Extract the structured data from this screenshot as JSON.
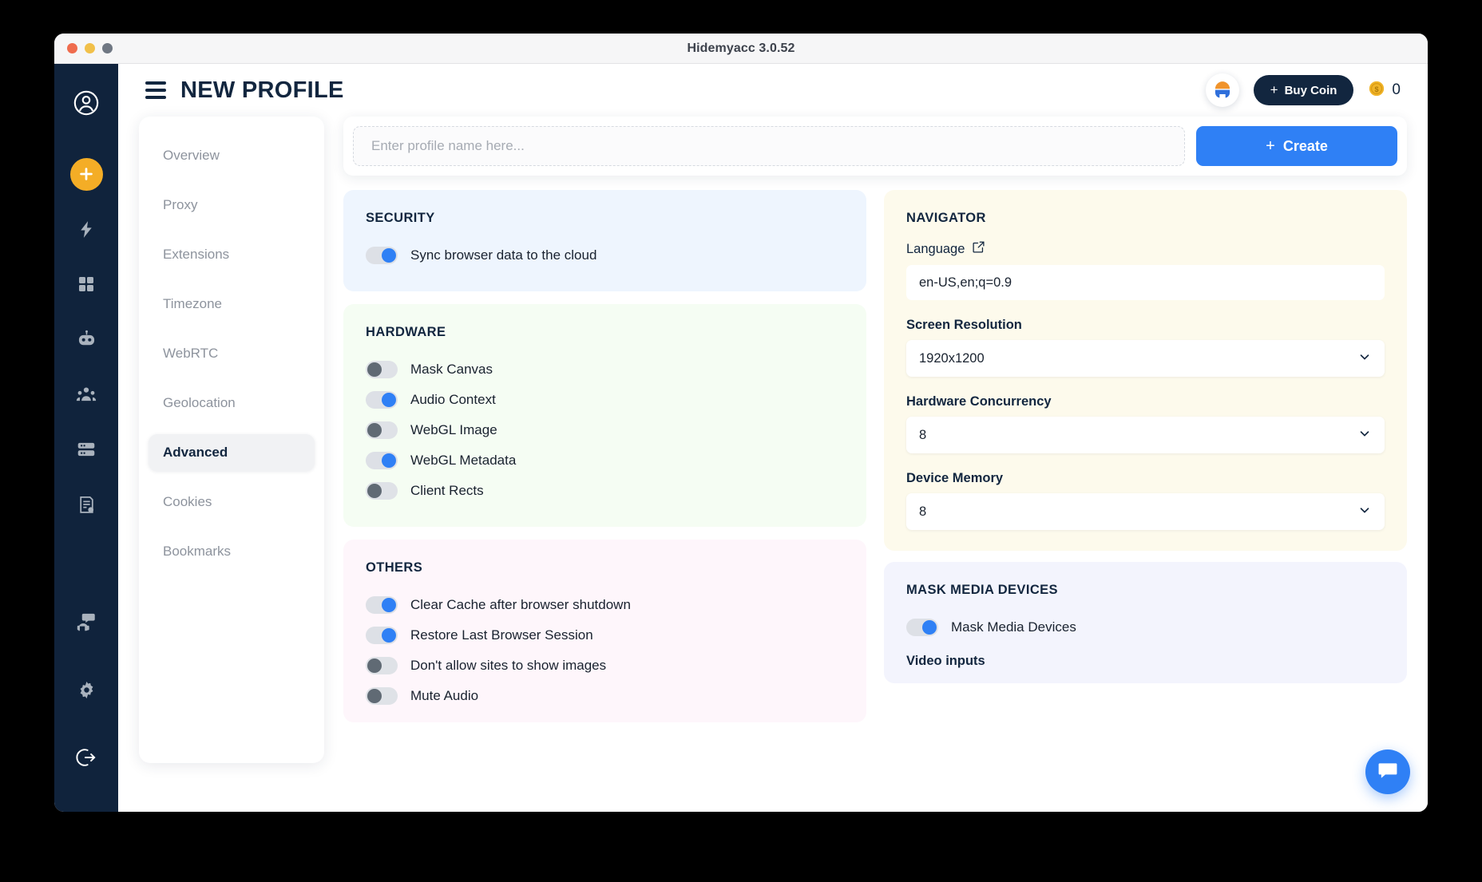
{
  "window": {
    "title": "Hidemyacc 3.0.52",
    "traffic_lights": [
      "close",
      "minimize",
      "maximize"
    ]
  },
  "header": {
    "menu_icon": "hamburger-icon",
    "title": "NEW PROFILE",
    "brand_icon": "brand-logo-icon",
    "buy_coin_label": "Buy Coin",
    "buy_coin_plus": "+",
    "coin_icon": "coin-icon",
    "coin_count": "0"
  },
  "rail": {
    "items": [
      {
        "name": "account-avatar",
        "icon": "user-circle-icon"
      },
      {
        "name": "new-profile",
        "icon": "plus-circle-icon",
        "accent": "#f4ad26"
      },
      {
        "name": "automation",
        "icon": "lightning-bolt-icon"
      },
      {
        "name": "apps",
        "icon": "grid-apps-icon"
      },
      {
        "name": "bot",
        "icon": "robot-icon"
      },
      {
        "name": "team",
        "icon": "team-people-icon"
      },
      {
        "name": "proxy",
        "icon": "server-stack-icon"
      },
      {
        "name": "billing",
        "icon": "invoice-icon"
      }
    ],
    "bottom_items": [
      {
        "name": "support",
        "icon": "headset-chat-icon"
      },
      {
        "name": "settings",
        "icon": "gear-icon"
      },
      {
        "name": "logout",
        "icon": "logout-arrow-icon"
      }
    ]
  },
  "profile_bar": {
    "input_value": "",
    "input_placeholder": "Enter profile name here...",
    "create_label": "Create",
    "create_plus": "+"
  },
  "nav": {
    "items": [
      {
        "label": "Overview",
        "active": false
      },
      {
        "label": "Proxy",
        "active": false
      },
      {
        "label": "Extensions",
        "active": false
      },
      {
        "label": "Timezone",
        "active": false
      },
      {
        "label": "WebRTC",
        "active": false
      },
      {
        "label": "Geolocation",
        "active": false
      },
      {
        "label": "Advanced",
        "active": true
      },
      {
        "label": "Cookies",
        "active": false
      },
      {
        "label": "Bookmarks",
        "active": false
      }
    ]
  },
  "security": {
    "heading": "SECURITY",
    "toggles": [
      {
        "label": "Sync browser data to the cloud",
        "on": true
      }
    ]
  },
  "hardware": {
    "heading": "HARDWARE",
    "toggles": [
      {
        "label": "Mask Canvas",
        "on": false
      },
      {
        "label": "Audio Context",
        "on": true
      },
      {
        "label": "WebGL Image",
        "on": false
      },
      {
        "label": "WebGL Metadata",
        "on": true
      },
      {
        "label": "Client Rects",
        "on": false
      }
    ]
  },
  "others": {
    "heading": "OTHERS",
    "toggles": [
      {
        "label": "Clear Cache after browser shutdown",
        "on": true
      },
      {
        "label": "Restore Last Browser Session",
        "on": true
      },
      {
        "label": "Don't allow sites to show images",
        "on": false
      },
      {
        "label": "Mute Audio",
        "on": false
      }
    ]
  },
  "navigator": {
    "heading": "NAVIGATOR",
    "language_label": "Language",
    "language_edit_icon": "edit-pencil-square-icon",
    "language_value": "en-US,en;q=0.9",
    "screen_resolution_label": "Screen Resolution",
    "screen_resolution_value": "1920x1200",
    "hardware_concurrency_label": "Hardware Concurrency",
    "hardware_concurrency_value": "8",
    "device_memory_label": "Device Memory",
    "device_memory_value": "8",
    "chevron_icon": "chevron-down-icon"
  },
  "mask_media": {
    "heading": "MASK MEDIA DEVICES",
    "toggle_label": "Mask Media Devices",
    "toggle_on": true,
    "video_inputs_label": "Video inputs"
  },
  "chat": {
    "icon": "chat-bubble-icon"
  },
  "colors": {
    "accent_blue": "#2f80f5",
    "rail_navy": "#10233c",
    "plus_yellow": "#f4ad26",
    "panel_security": "#eef5fe",
    "panel_hardware": "#f5fdf3",
    "panel_others": "#fef6fb",
    "panel_navigator": "#fdfaec",
    "panel_media": "#f3f4fd"
  }
}
